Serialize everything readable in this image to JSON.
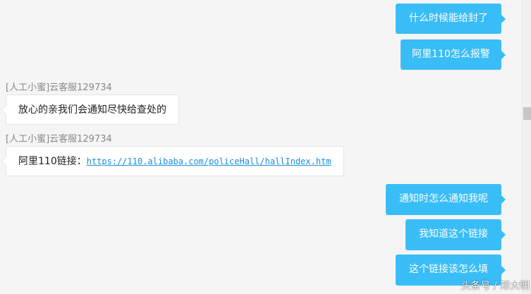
{
  "messages": {
    "out_1": "什么时候能给封了",
    "out_2": "阿里110怎么报警",
    "in_1": {
      "sender": "[人工小蜜]云客服129734",
      "text": "放心的亲我们会通知尽快给查处的"
    },
    "in_2": {
      "sender": "[人工小蜜]云客服129734",
      "prefix": "阿里110链接：",
      "link": "https://110.alibaba.com/policeHall/hallIndex.htm"
    },
    "out_3": "通知时怎么通知我呢",
    "out_4": "我知道这个链接",
    "out_5": "这个链接该怎么填"
  },
  "watermark": "头条号 / 邓大明",
  "colors": {
    "outgoing_bubble": "#39bdf7",
    "incoming_bubble": "#ffffff",
    "background": "#f5f5f5",
    "link": "#1a8ed8"
  }
}
